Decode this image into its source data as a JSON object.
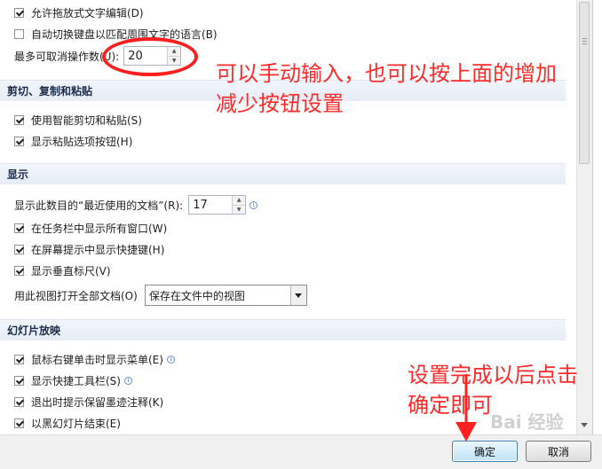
{
  "options": {
    "allow_drag_text": {
      "label": "允许拖放式文字编辑(D)",
      "checked": true
    },
    "auto_keyboard": {
      "label": "自动切换键盘以匹配周围文字的语言(B)",
      "checked": false
    },
    "max_undo": {
      "label": "最多可取消操作数(U):",
      "value": "20"
    }
  },
  "sections": {
    "cut_copy_paste": {
      "title": "剪切、复制和粘贴",
      "smart_cut": {
        "label": "使用智能剪切和粘贴(S)",
        "checked": true
      },
      "paste_options": {
        "label": "显示粘贴选项按钮(H)",
        "checked": true
      }
    },
    "display": {
      "title": "显示",
      "recent_docs": {
        "label": "显示此数目的“最近使用的文档”(R):",
        "value": "17"
      },
      "taskbar_windows": {
        "label": "在任务栏中显示所有窗口(W)",
        "checked": true
      },
      "screentip_shortcuts": {
        "label": "在屏幕提示中显示快捷键(H)",
        "checked": true
      },
      "vertical_ruler": {
        "label": "显示垂直标尺(V)",
        "checked": true
      },
      "open_view": {
        "label": "用此视图打开全部文档(O)",
        "selected": "保存在文件中的视图"
      }
    },
    "slideshow": {
      "title": "幻灯片放映",
      "right_click_menu": {
        "label": "鼠标右键单击时显示菜单(E)",
        "checked": true
      },
      "popup_toolbar": {
        "label": "显示快捷工具栏(S)",
        "checked": true
      },
      "keep_ink": {
        "label": "退出时提示保留墨迹注释(K)",
        "checked": true
      },
      "end_black": {
        "label": "以黑幻灯片结束(E)",
        "checked": true
      }
    }
  },
  "footer": {
    "ok": "确定",
    "cancel": "取消"
  },
  "annotations": {
    "note1_line1": "可以手动输入，也可以按上面的增加",
    "note1_line2": "减少按钮设置",
    "note2_line1": "设置完成以后点击",
    "note2_line2": "确定即可",
    "color": "#ff2a2a"
  },
  "watermark": "Bai 经验"
}
